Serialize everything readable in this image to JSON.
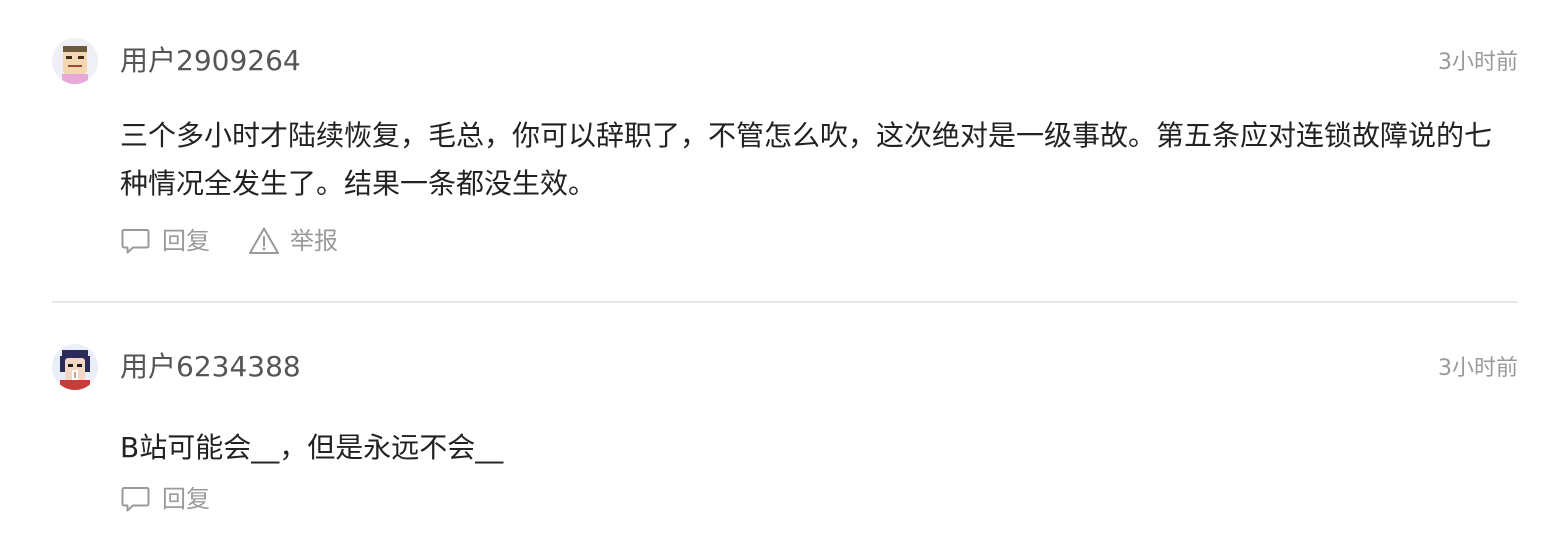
{
  "comments": [
    {
      "username": "用户2909264",
      "time": "3小时前",
      "content": "三个多小时才陆续恢复，毛总，你可以辞职了，不管怎么吹，这次绝对是一级事故。第五条应对连锁故障说的七种情况全发生了。结果一条都没生效。",
      "actions": {
        "reply_label": "回复",
        "report_label": "举报"
      }
    },
    {
      "username": "用户6234388",
      "time": "3小时前",
      "content": "B站可能会__，但是永远不会__",
      "actions": {
        "reply_label": "回复"
      }
    }
  ],
  "icons": {
    "reply": "comment-bubble-icon",
    "report": "warning-triangle-icon"
  },
  "colors": {
    "username": "#555555",
    "time": "#9a9a9a",
    "content": "#222222",
    "action": "#9a9a9a",
    "divider": "#e6e6e6"
  }
}
